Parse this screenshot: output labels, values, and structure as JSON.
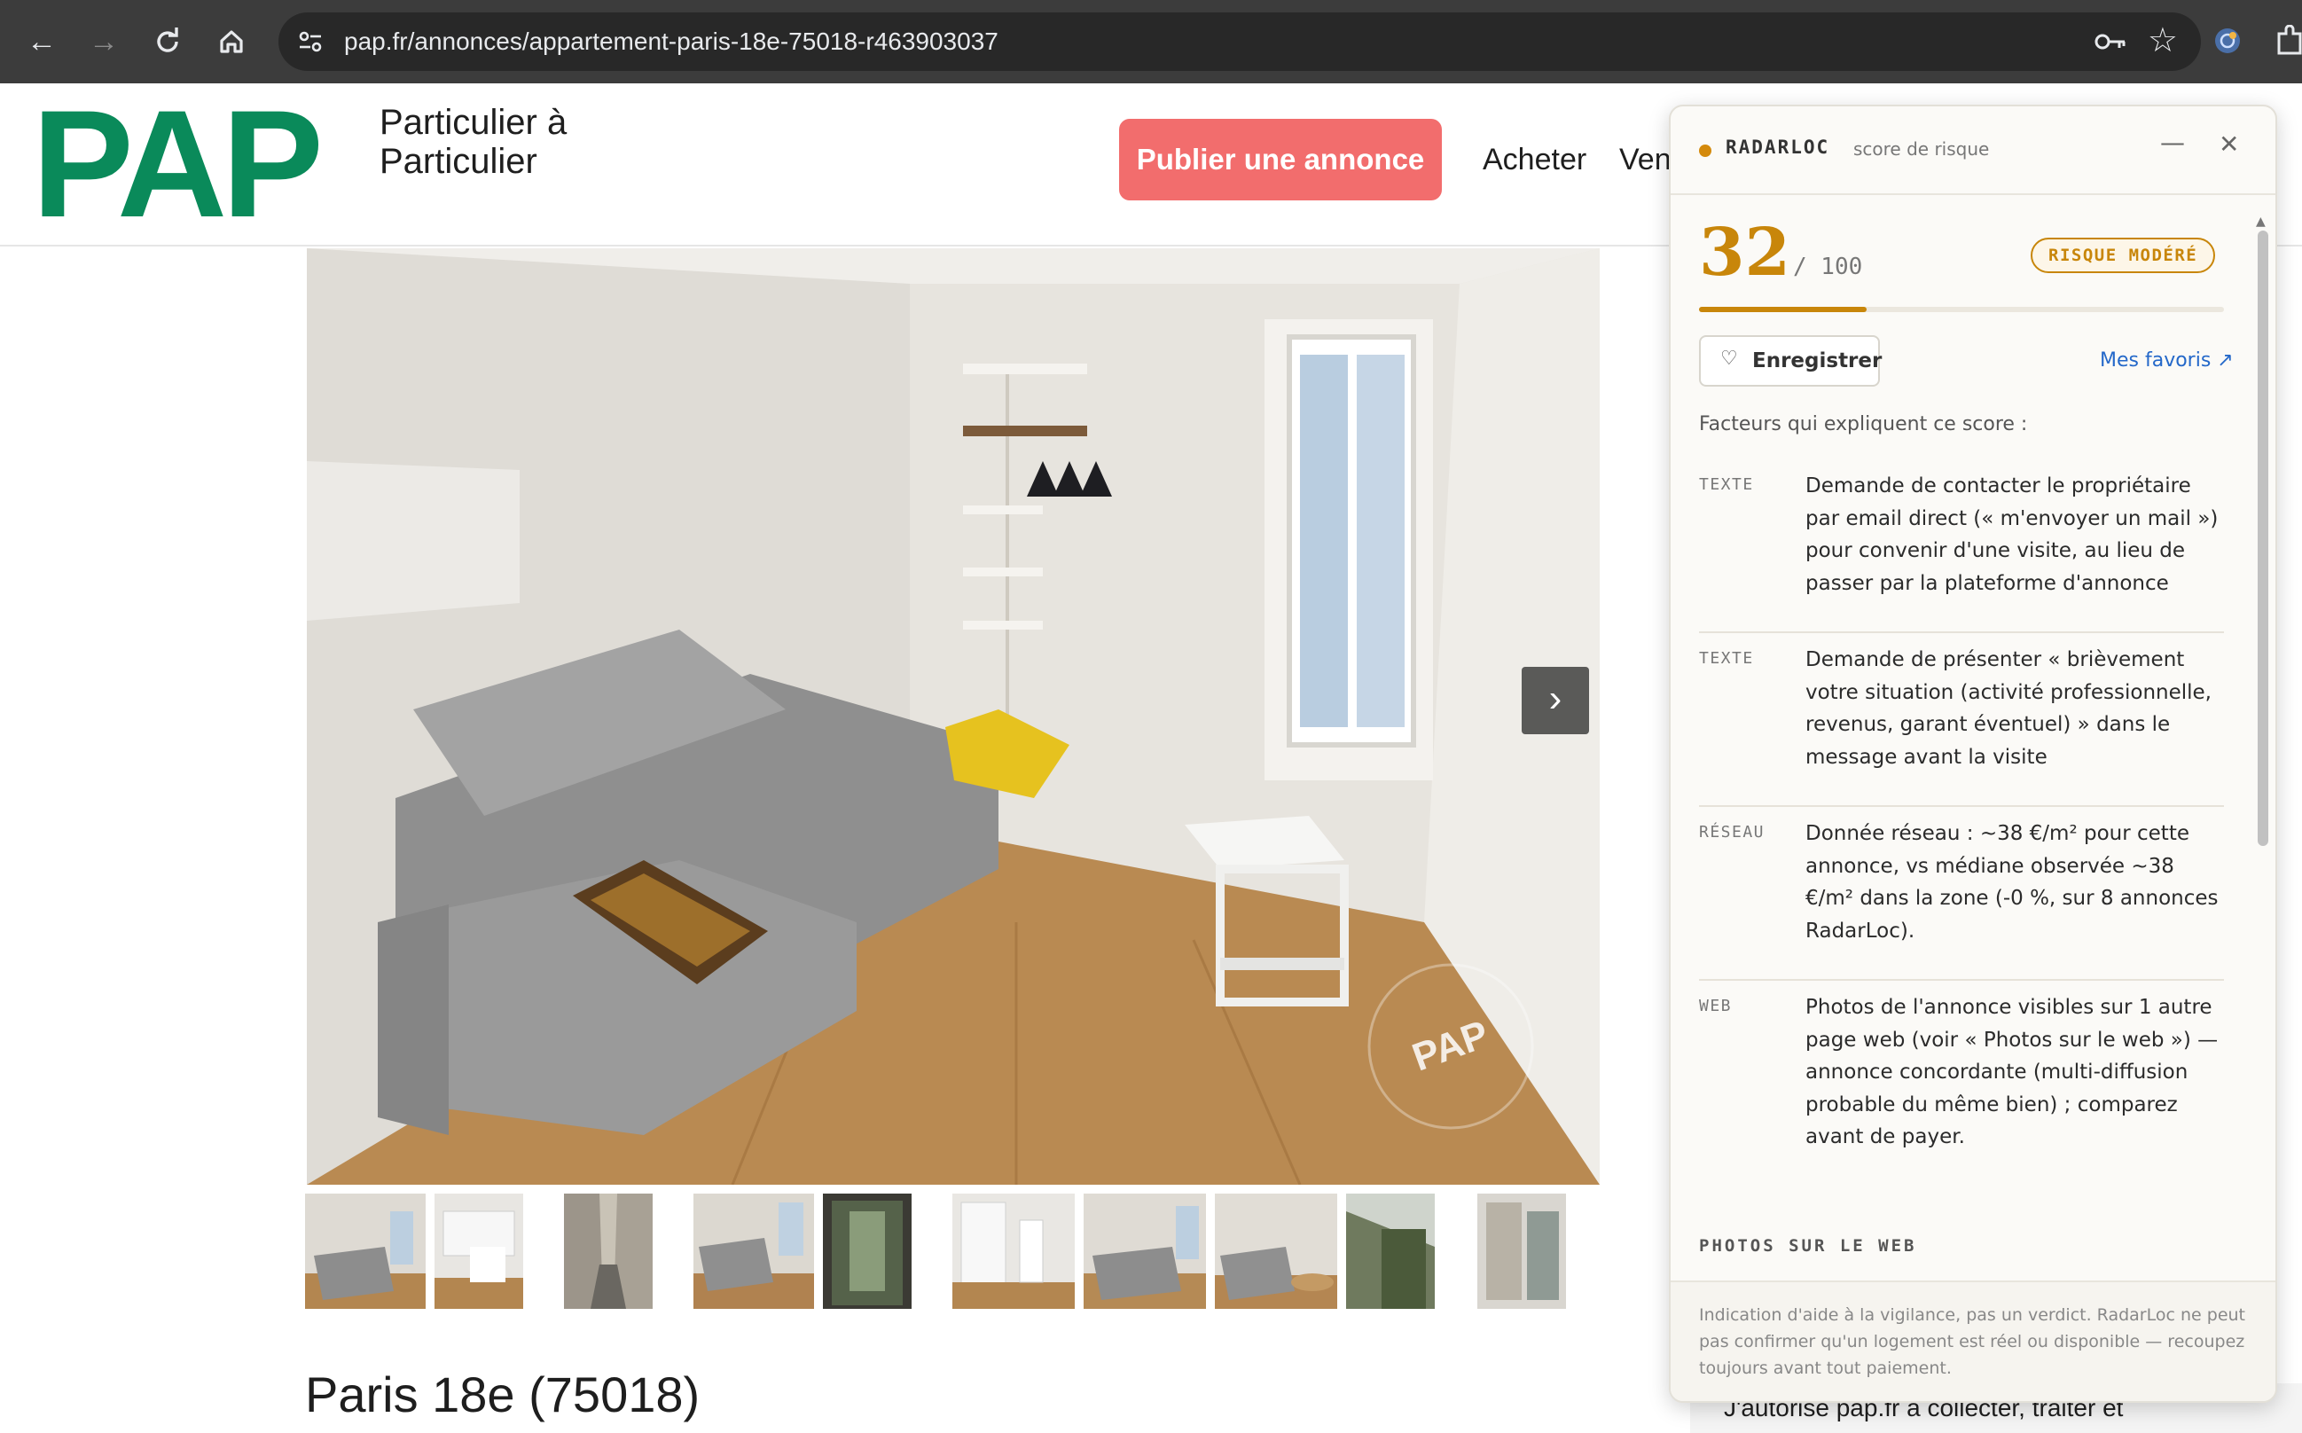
{
  "browser": {
    "url": "pap.fr/annonces/appartement-paris-18e-75018-r463903037"
  },
  "header": {
    "logo_text": "PAP",
    "tagline_line1": "Particulier à",
    "tagline_line2": "Particulier",
    "publish_button": "Publier une annonce",
    "nav": [
      "Acheter",
      "Ven"
    ]
  },
  "listing": {
    "title": "Paris 18e (75018)",
    "watermark": "PAP",
    "consent_text": "J'autorise pap.fr a collecter, traiter et"
  },
  "radarloc": {
    "brand": "RADARLOC",
    "subtitle": "score de risque",
    "score": "32",
    "score_max": "/ 100",
    "score_fraction": 0.32,
    "risk_label": "RISQUE MODÉRÉ",
    "save_label": "Enregistrer",
    "favorites_link": "Mes favoris ↗",
    "factors_title": "Facteurs qui expliquent ce score :",
    "factors": [
      {
        "tag": "TEXTE",
        "text": "Demande de contacter le propriétaire par email direct (« m'envoyer un mail ») pour convenir d'une visite, au lieu de passer par la plateforme d'annonce"
      },
      {
        "tag": "TEXTE",
        "text": "Demande de présenter « brièvement votre situation (activité professionnelle, revenus, garant éventuel) » dans le message avant la visite"
      },
      {
        "tag": "RÉSEAU",
        "text": "Donnée réseau : ~38 €/m² pour cette annonce, vs médiane observée ~38 €/m² dans la zone (-0 %, sur 8 annonces RadarLoc)."
      },
      {
        "tag": "WEB",
        "text": "Photos de l'annonce visibles sur 1 autre page web (voir « Photos sur le web ») — annonce concordante (multi-diffusion probable du même bien) ; comparez avant de payer."
      }
    ],
    "photos_section_title": "PHOTOS SUR LE WEB",
    "footer_note": "Indication d'aide à la vigilance, pas un verdict. RadarLoc ne peut pas confirmer qu'un logement est réel ou disponible — recoupez toujours avant tout paiement."
  },
  "colors": {
    "pap_green": "#0a8a5a",
    "publish_red": "#f26d6d",
    "risk_amber": "#c8860a",
    "link_blue": "#2468c9"
  }
}
